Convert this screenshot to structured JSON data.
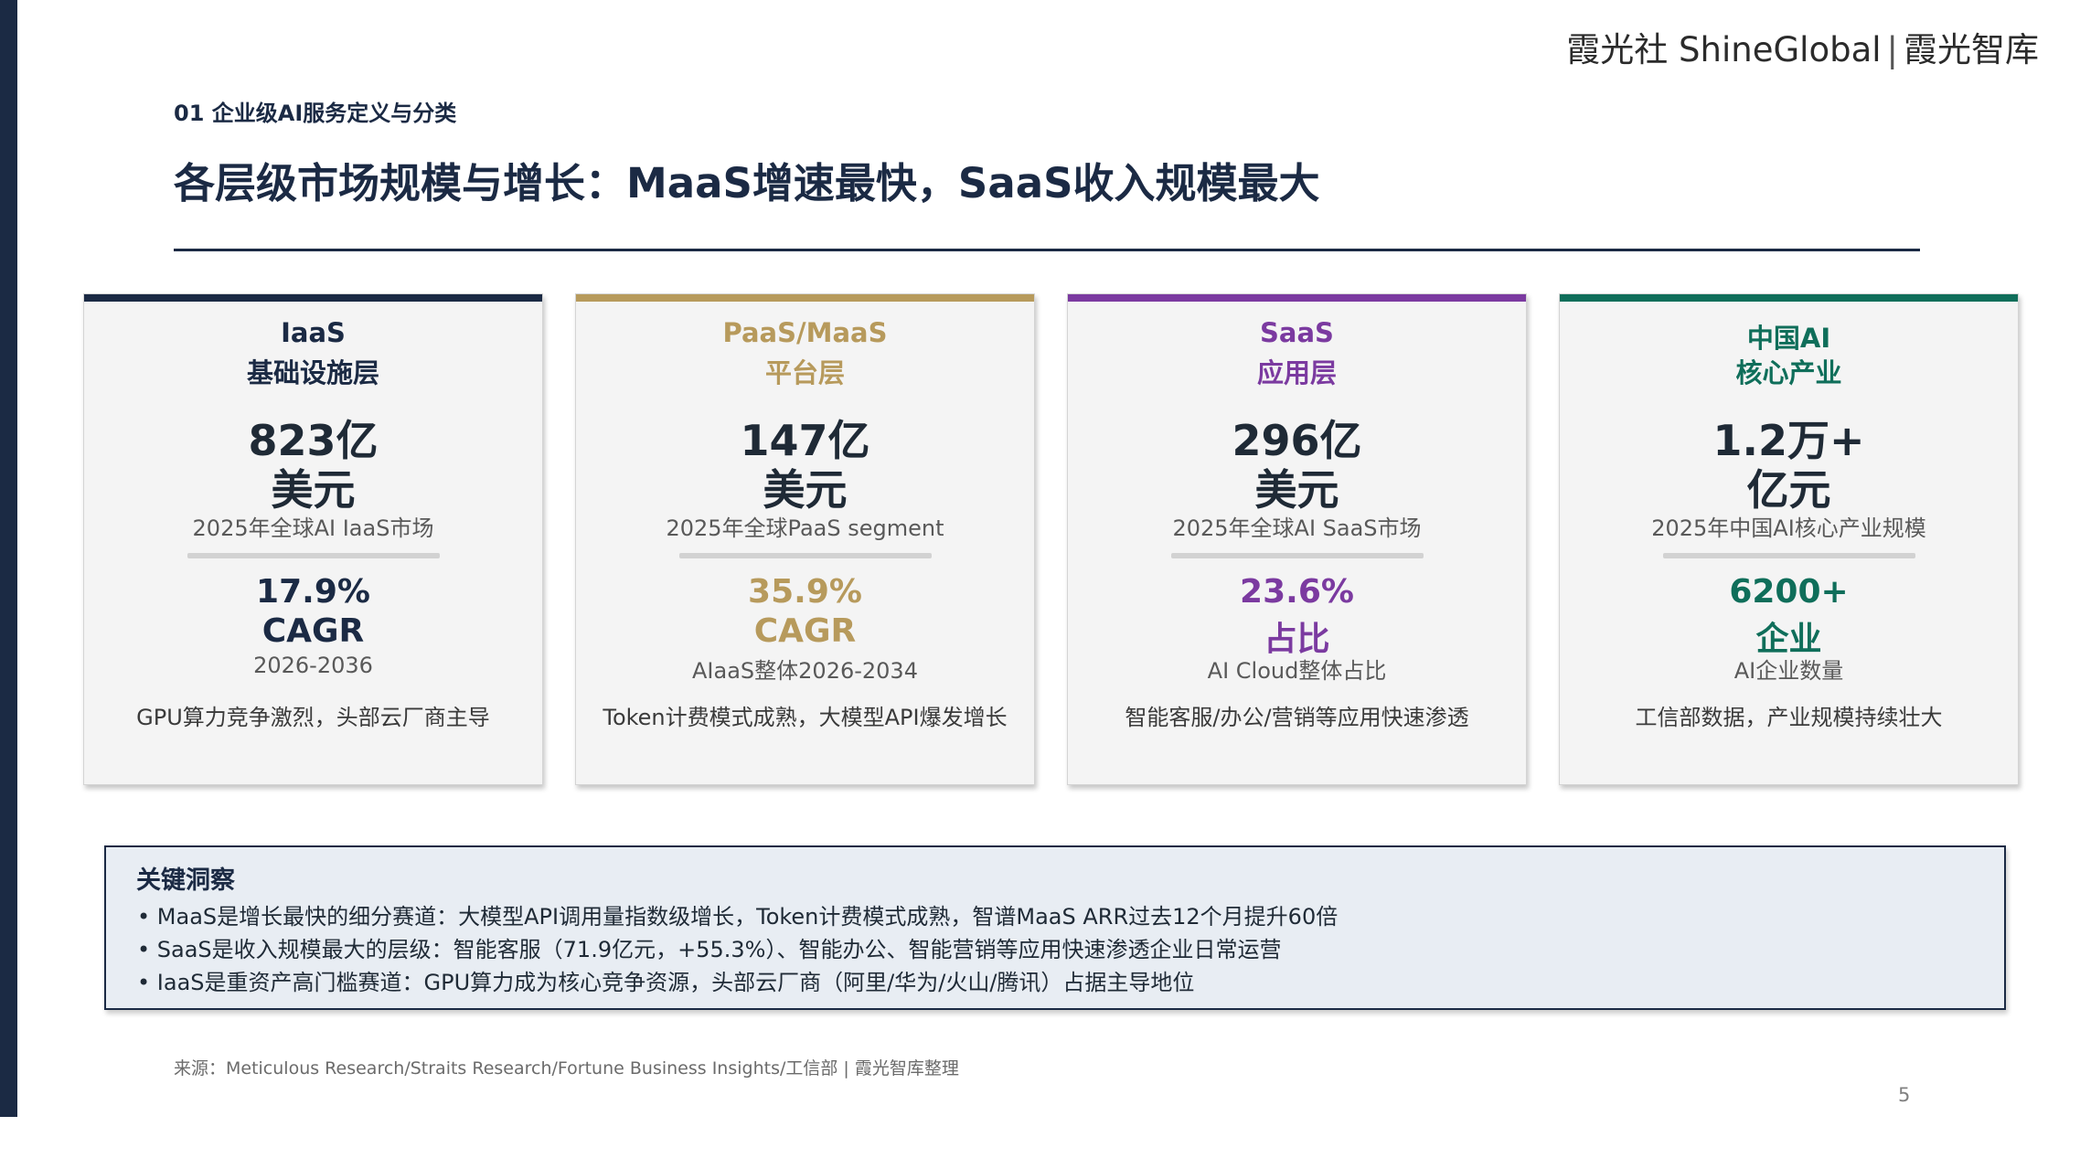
{
  "brand": {
    "name_left": "霞光社 ShineGlobal",
    "separator": "|",
    "name_right": "霞光智库"
  },
  "section_label": "01 企业级AI服务定义与分类",
  "page_title": "各层级市场规模与增长：MaaS增速最快，SaaS收入规模最大",
  "colors": {
    "navy": "#1b2a44",
    "gold": "#b79a5c",
    "purple": "#7b3aa0",
    "green": "#0f6e5a"
  },
  "cards": [
    {
      "title_line1": "IaaS",
      "title_line2": "基础设施层",
      "value_line1": "823亿",
      "value_line2": "美元",
      "value_desc": "2025年全球AI IaaS市场",
      "stat_line1": "17.9%",
      "stat_line2": "CAGR",
      "stat_desc": "2026-2036",
      "note": "GPU算力竞争激烈，头部云厂商主导",
      "accent": "#1b2a44"
    },
    {
      "title_line1": "PaaS/MaaS",
      "title_line2": "平台层",
      "value_line1": "147亿",
      "value_line2": "美元",
      "value_desc": "2025年全球PaaS segment",
      "stat_line1": "35.9%",
      "stat_line2": "CAGR",
      "stat_desc": "AIaaS整体2026-2034",
      "note": "Token计费模式成熟，大模型API爆发增长",
      "accent": "#b79a5c"
    },
    {
      "title_line1": "SaaS",
      "title_line2": "应用层",
      "value_line1": "296亿",
      "value_line2": "美元",
      "value_desc": "2025年全球AI SaaS市场",
      "stat_line1": "23.6%",
      "stat_line2": "占比",
      "stat_desc": "AI Cloud整体占比",
      "note": "智能客服/办公/营销等应用快速渗透",
      "accent": "#7b3aa0"
    },
    {
      "title_line1": "中国AI",
      "title_line2": "核心产业",
      "value_line1": "1.2万+",
      "value_line2": "亿元",
      "value_desc": "2025年中国AI核心产业规模",
      "stat_line1": "6200+",
      "stat_line2": "企业",
      "stat_desc": "AI企业数量",
      "note": "工信部数据，产业规模持续壮大",
      "accent": "#0f6e5a"
    }
  ],
  "insight": {
    "heading": "关键洞察",
    "bullets": [
      "• MaaS是增长最快的细分赛道：大模型API调用量指数级增长，Token计费模式成熟，智谱MaaS ARR过去12个月提升60倍",
      "• SaaS是收入规模最大的层级：智能客服（71.9亿元，+55.3%）、智能办公、智能营销等应用快速渗透企业日常运营",
      "• IaaS是重资产高门槛赛道：GPU算力成为核心竞争资源，头部云厂商（阿里/华为/火山/腾讯）占据主导地位"
    ]
  },
  "source": "来源：Meticulous Research/Straits Research/Fortune Business Insights/工信部 | 霞光智库整理",
  "page_number": "5"
}
